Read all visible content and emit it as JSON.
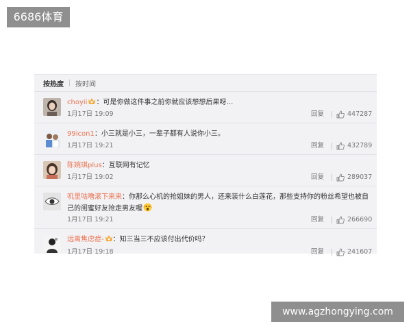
{
  "watermark_top": "6686体育",
  "watermark_bottom": "www.agzhongying.com",
  "sort_tabs": [
    "按热度",
    "按时间"
  ],
  "reply_label": "回复",
  "colors": {
    "username": "#eb7350",
    "panel_bg": "#f2f2f5"
  },
  "comments": [
    {
      "user": "choyii",
      "badge": "vip-icon",
      "text": "：可是你做这件事之前你就应该想想后果呀…",
      "time": "1月17日 19:09",
      "likes": "447287"
    },
    {
      "user": "99icon1",
      "text": "：小三就是小三，一辈子都有人说你小三。",
      "time": "1月17日 19:21",
      "likes": "432789"
    },
    {
      "user": "陈婉琪plus",
      "text": "：互联网有记忆",
      "time": "1月17日 19:02",
      "likes": "289037"
    },
    {
      "user": "叽里咕噜滚下来来",
      "text": "：你那么心机的抢姐妹的男人，还来装什么白莲花，那些支持你的粉丝希望也被自己的闺蜜好友抢走男友喔",
      "emoji": "scream-emoji-icon",
      "time": "1月17日 19:21",
      "likes": "266690"
    },
    {
      "user": "远离焦虑症-",
      "badge": "vip-icon",
      "text": "：知三当三不应该付出代价吗？",
      "time": "1月17日 19:18",
      "likes": "241607"
    }
  ]
}
